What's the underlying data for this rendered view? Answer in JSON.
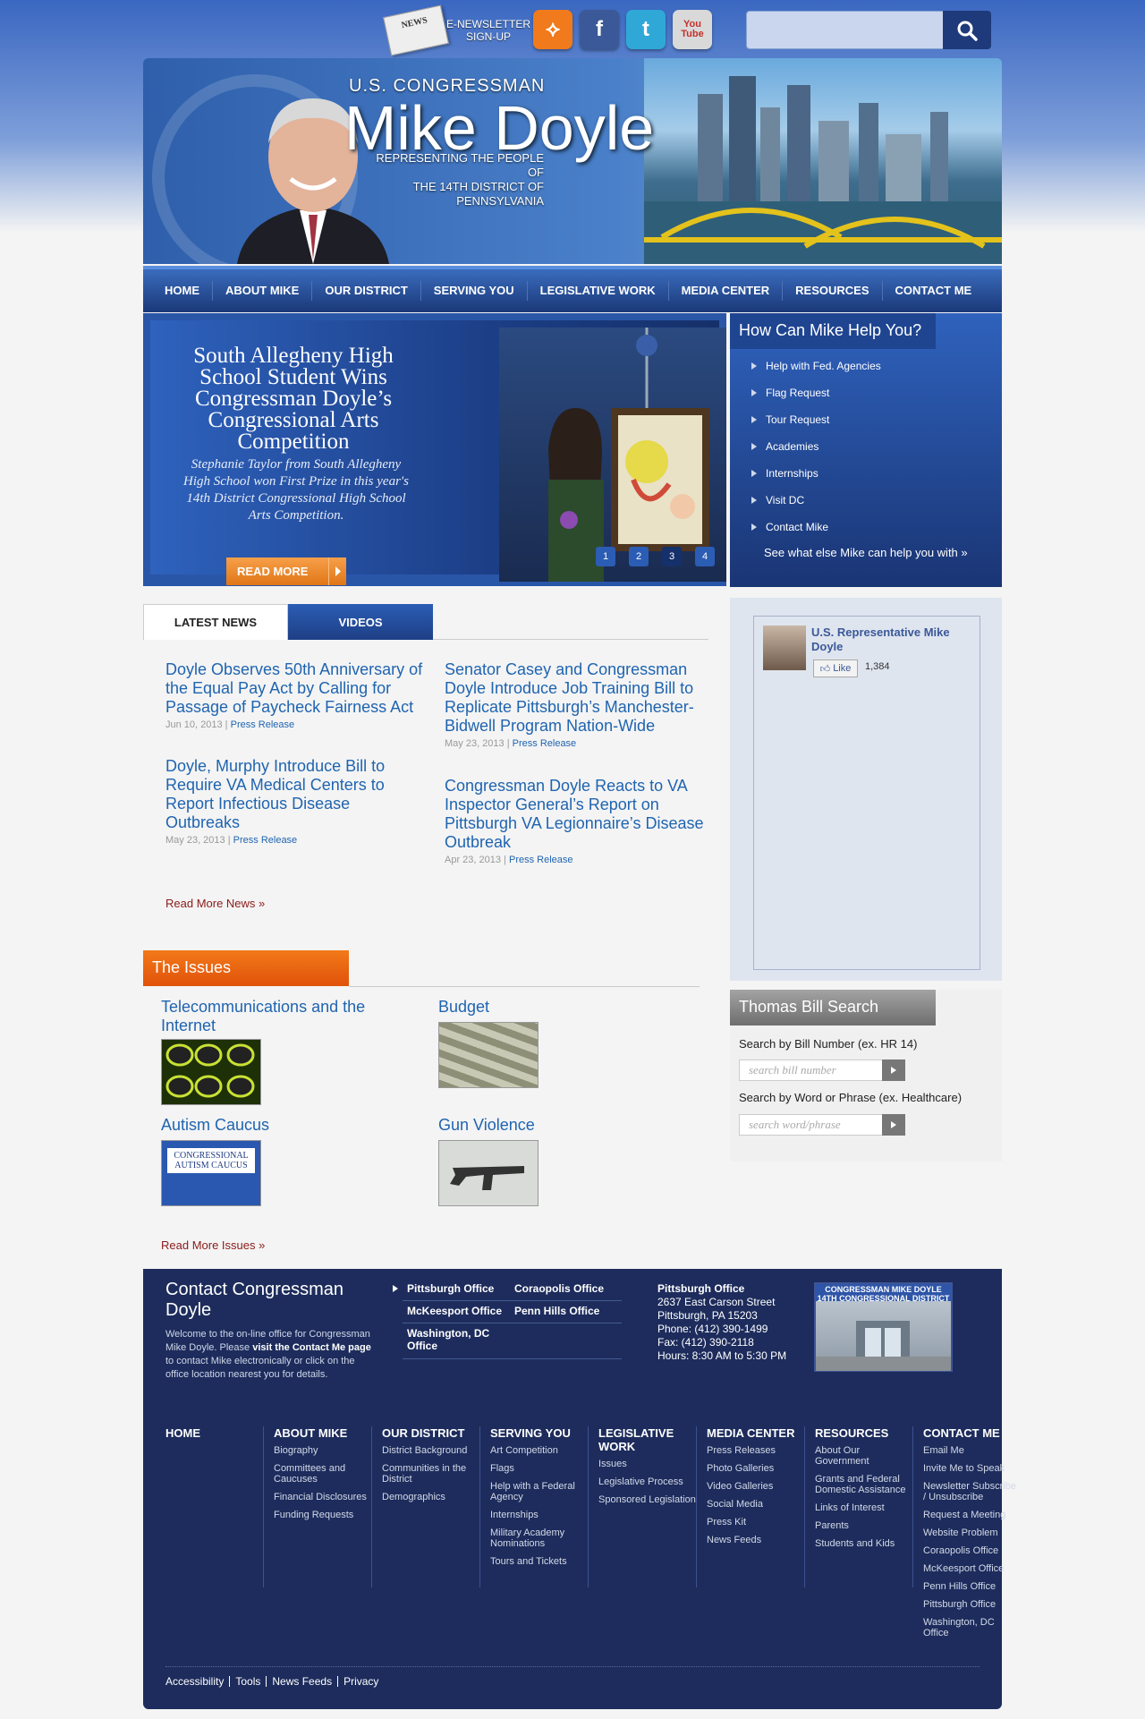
{
  "top": {
    "newsletter_img": "NEWS",
    "newsletter": "E-NEWSLETTER SIGN-UP",
    "social": [
      {
        "name": "rss-icon",
        "glyph": "⟡",
        "color": "#f07a1c"
      },
      {
        "name": "facebook-icon",
        "glyph": "f",
        "color": "#3b5998"
      },
      {
        "name": "twitter-icon",
        "glyph": "t",
        "color": "#2fa8d8"
      },
      {
        "name": "youtube-icon",
        "glyph": "You\nTube",
        "color": "#d9d9d9"
      }
    ],
    "search_placeholder": ""
  },
  "header": {
    "pre_title": "U.S. CONGRESSMAN",
    "title": "Mike Doyle",
    "subtitle_1": "REPRESENTING THE PEOPLE OF",
    "subtitle_2": "THE 14TH DISTRICT OF PENNSYLVANIA"
  },
  "nav": [
    "HOME",
    "ABOUT MIKE",
    "OUR DISTRICT",
    "SERVING YOU",
    "LEGISLATIVE WORK",
    "MEDIA CENTER",
    "RESOURCES",
    "CONTACT ME"
  ],
  "slider": {
    "title": "South Allegheny High School Student Wins Congressman Doyle’s Congressional Arts Competition",
    "description": "Stephanie Taylor from South Allegheny High School won First Prize in this year's 14th District Congressional High School Arts Competition.",
    "button": "READ MORE",
    "pages": [
      "1",
      "2",
      "3",
      "4"
    ],
    "active_page": 3
  },
  "help": {
    "title": "How Can Mike Help You?",
    "items": [
      "Help with Fed. Agencies",
      "Flag Request",
      "Tour Request",
      "Academies",
      "Internships",
      "Visit DC",
      "Contact Mike"
    ],
    "more": "See what else Mike can help you with »"
  },
  "tabs": [
    "LATEST NEWS",
    "VIDEOS"
  ],
  "news": [
    {
      "title": "Doyle Observes 50th Anniversary of the Equal Pay Act by Calling for Passage of Paycheck Fairness Act",
      "date": "Jun 10, 2013",
      "type": "Press Release"
    },
    {
      "title": "Doyle, Murphy Introduce Bill to Require VA Medical Centers to Report Infectious Disease Outbreaks",
      "date": "May 23, 2013",
      "type": "Press Release"
    },
    {
      "title": "Senator Casey and Congressman Doyle Introduce Job Training Bill to Replicate Pittsburgh’s Manchester-Bidwell Program Nation-Wide",
      "date": "May 23, 2013",
      "type": "Press Release"
    },
    {
      "title": "Congressman Doyle Reacts to VA Inspector General’s Report on Pittsburgh VA Legionnaire’s Disease Outbreak",
      "date": "Apr 23, 2013",
      "type": "Press Release"
    }
  ],
  "read_more_news": "Read More News »",
  "facebook": {
    "name": "U.S. Representative Mike Doyle",
    "like": "Like",
    "count": "1,384"
  },
  "issues": {
    "title": "The Issues",
    "items": [
      "Telecommunications and the Internet",
      "Budget",
      "Autism Caucus",
      "Gun Violence"
    ],
    "autism_img_text": "CONGRESSIONAL AUTISM CAUCUS",
    "read_more": "Read More Issues »"
  },
  "thomas": {
    "title": "Thomas Bill Search",
    "label_number": "Search by Bill Number (ex. HR 14)",
    "placeholder_number": "search bill number",
    "label_word": "Search by Word or Phrase (ex. Healthcare)",
    "placeholder_word": "search word/phrase"
  },
  "footer": {
    "contact_title": "Contact Congressman Doyle",
    "contact_text_1": "Welcome to the on-line office for Congressman Mike Doyle. Please ",
    "contact_link": "visit the Contact Me page",
    "contact_text_2": " to contact Mike electronically or click on the office location nearest you for details.",
    "offices": [
      "Pittsburgh Office",
      "Coraopolis Office",
      "McKeesport Office",
      "Penn Hills Office",
      "Washington, DC Office"
    ],
    "address": {
      "name": "Pittsburgh Office",
      "street": "2637 East Carson Street",
      "city": "Pittsburgh, PA 15203",
      "phone": "Phone: (412) 390-1499",
      "fax": "Fax: (412) 390-2118",
      "hours": "Hours: 8:30 AM to 5:30 PM"
    },
    "building_banner": "CONGRESSMAN MIKE DOYLE 14TH CONGRESSIONAL DISTRICT",
    "columns": [
      {
        "heading": "HOME",
        "items": []
      },
      {
        "heading": "ABOUT MIKE",
        "items": [
          "Biography",
          "Committees and Caucuses",
          "Financial Disclosures",
          "Funding Requests"
        ]
      },
      {
        "heading": "OUR DISTRICT",
        "items": [
          "District Background",
          "Communities in the District",
          "Demographics"
        ]
      },
      {
        "heading": "SERVING YOU",
        "items": [
          "Art Competition",
          "Flags",
          "Help with a Federal Agency",
          "Internships",
          "Military Academy Nominations",
          "Tours and Tickets"
        ]
      },
      {
        "heading": "LEGISLATIVE WORK",
        "items": [
          "Issues",
          "Legislative Process",
          "Sponsored Legislation"
        ]
      },
      {
        "heading": "MEDIA CENTER",
        "items": [
          "Press Releases",
          "Photo Galleries",
          "Video Galleries",
          "Social Media",
          "Press Kit",
          "News Feeds"
        ]
      },
      {
        "heading": "RESOURCES",
        "items": [
          "About Our Government",
          "Grants and Federal Domestic Assistance",
          "Links of Interest",
          "Parents",
          "Students and Kids"
        ]
      },
      {
        "heading": "CONTACT ME",
        "items": [
          "Email Me",
          "Invite Me to Speak",
          "Newsletter Subscribe / Unsubscribe",
          "Request a Meeting",
          "Website Problem",
          "Coraopolis Office",
          "McKeesport Office",
          "Penn Hills Office",
          "Pittsburgh Office",
          "Washington, DC Office"
        ]
      }
    ],
    "bottom_links": [
      "Accessibility",
      "Tools",
      "News Feeds",
      "Privacy"
    ]
  }
}
